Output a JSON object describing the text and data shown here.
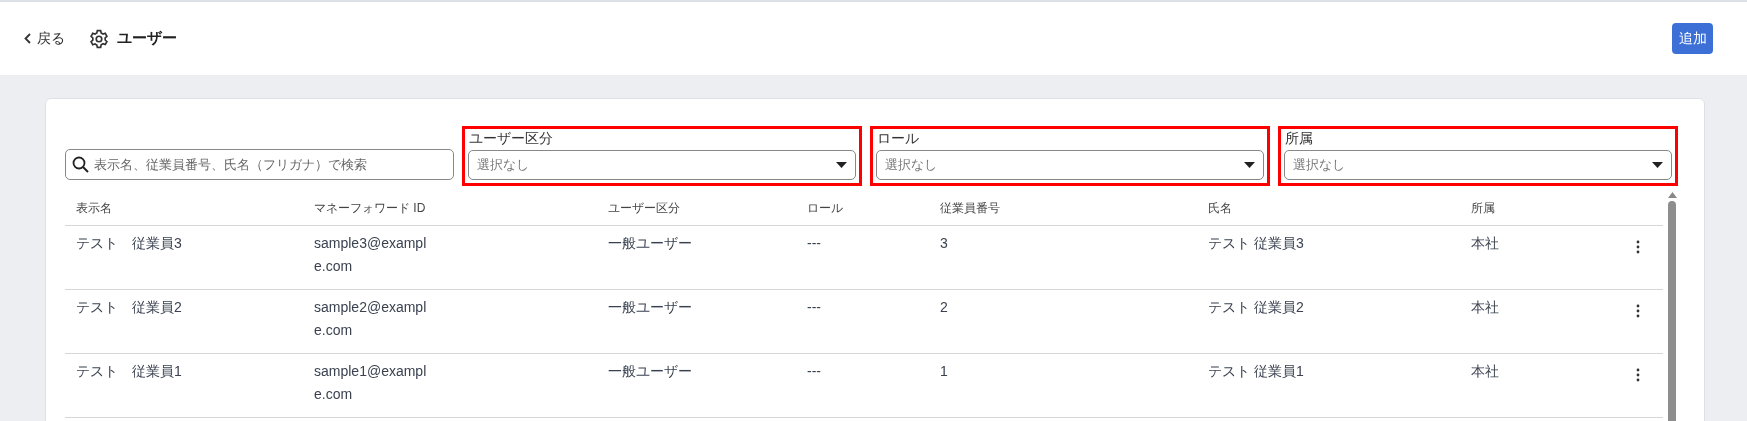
{
  "header": {
    "back": "戻る",
    "title": "ユーザー",
    "add_button": "追加"
  },
  "search": {
    "placeholder": "表示名、従業員番号、氏名（フリガナ）で検索"
  },
  "filters": [
    {
      "label": "ユーザー区分",
      "placeholder": "選択なし",
      "highlighted": true
    },
    {
      "label": "ロール",
      "placeholder": "選択なし",
      "highlighted": true
    },
    {
      "label": "所属",
      "placeholder": "選択なし",
      "highlighted": true
    }
  ],
  "table": {
    "columns": [
      "表示名",
      "マネーフォワード ID",
      "ユーザー区分",
      "ロール",
      "従業員番号",
      "氏名",
      "所属"
    ],
    "rows": [
      [
        "テスト　従業員3",
        "sample3@example.com",
        "一般ユーザー",
        "---",
        "3",
        "テスト 従業員3",
        "本社"
      ],
      [
        "テスト　従業員2",
        "sample2@example.com",
        "一般ユーザー",
        "---",
        "2",
        "テスト 従業員2",
        "本社"
      ],
      [
        "テスト　従業員1",
        "sample1@example.com",
        "一般ユーザー",
        "---",
        "1",
        "テスト 従業員1",
        "本社"
      ]
    ]
  }
}
